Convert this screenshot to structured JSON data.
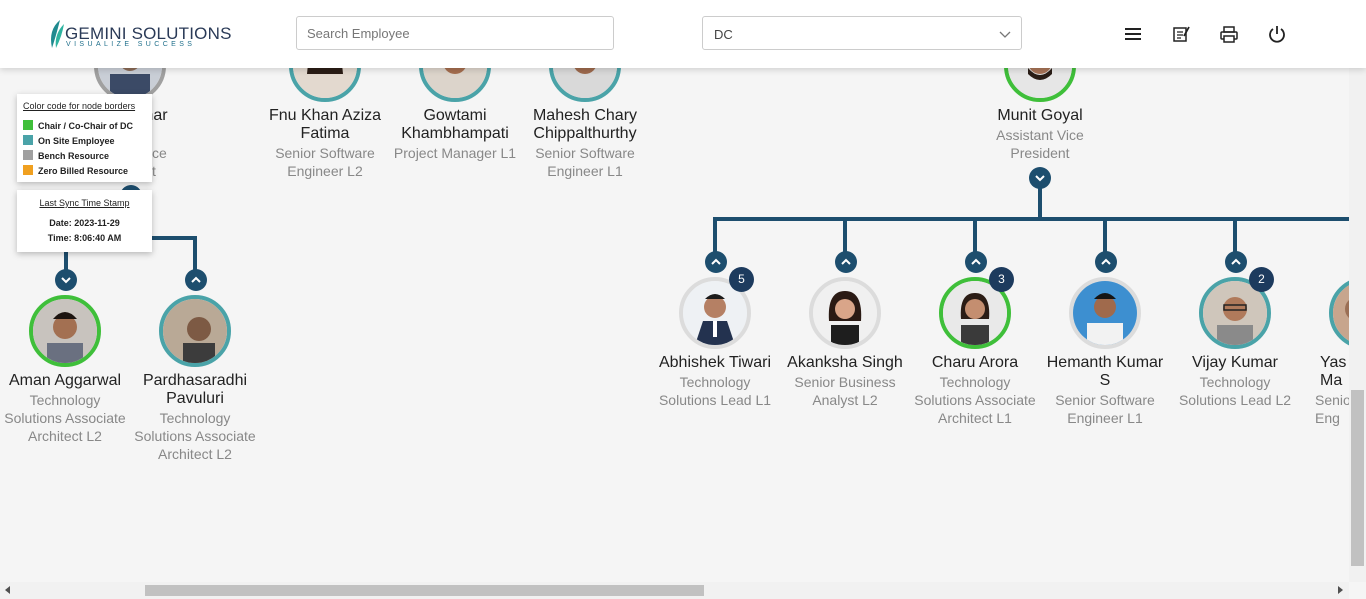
{
  "header": {
    "logo_main": "GEMINI SOLUTIONS",
    "logo_tagline": "VISUALIZE SUCCESS",
    "search": {
      "placeholder": "Search Employee",
      "value": ""
    },
    "location_select": {
      "value": "DC"
    },
    "icons": [
      "menu-icon",
      "notes-icon",
      "print-icon",
      "power-icon"
    ]
  },
  "legend": {
    "heading": "Color code for node borders",
    "items": [
      {
        "label": "Chair / Co-Chair of DC",
        "color": "#3fbf3a"
      },
      {
        "label": "On Site Employee",
        "color": "#4aa3a8"
      },
      {
        "label": "Bench Resource",
        "color": "#a0a0a0"
      },
      {
        "label": "Zero Billed Resource",
        "color": "#f0a020"
      }
    ]
  },
  "sync": {
    "heading": "Last Sync Time Stamp",
    "date_line": "Date: 2023-11-29",
    "time_line": "Time: 8:06:40 AM"
  },
  "partial_top_left": {
    "name_fragment": "mar",
    "title_fragment_1": "ce",
    "title_fragment_2": "t"
  },
  "top_row": [
    {
      "name": "Fnu Khan Aziza Fatima",
      "title": "Senior Software Engineer L2"
    },
    {
      "name": "Gowtami Khambhampati",
      "title": "Project Manager L1"
    },
    {
      "name": "Mahesh Chary Chippalthurthy",
      "title": "Senior Software Engineer L1"
    },
    {
      "name": "Munit Goyal",
      "title": "Assistant Vice President"
    }
  ],
  "left_children": [
    {
      "name": "Aman Aggarwal",
      "title": "Technology Solutions Associate Architect L2"
    },
    {
      "name": "Pardhasaradhi Pavuluri",
      "title": "Technology Solutions Associate Architect L2"
    }
  ],
  "right_children": [
    {
      "name": "Abhishek Tiwari",
      "title": "Technology Solutions Lead L1",
      "badge": "5"
    },
    {
      "name": "Akanksha Singh",
      "title": "Senior Business Analyst L2",
      "badge": ""
    },
    {
      "name": "Charu Arora",
      "title": "Technology Solutions Associate Architect L1",
      "badge": "3"
    },
    {
      "name": "Hemanth Kumar S",
      "title": "Senior Software Engineer L1",
      "badge": ""
    },
    {
      "name": "Vijay Kumar",
      "title": "Technology Solutions Lead L2",
      "badge": "2"
    },
    {
      "name": "Yas Ma",
      "title": "Senio Eng",
      "badge": ""
    }
  ],
  "colors": {
    "connector": "#1d4e6e",
    "onsite_border": "#4aa3a8",
    "chair_border": "#3fbf3a",
    "badge": "#1d3b5e"
  }
}
